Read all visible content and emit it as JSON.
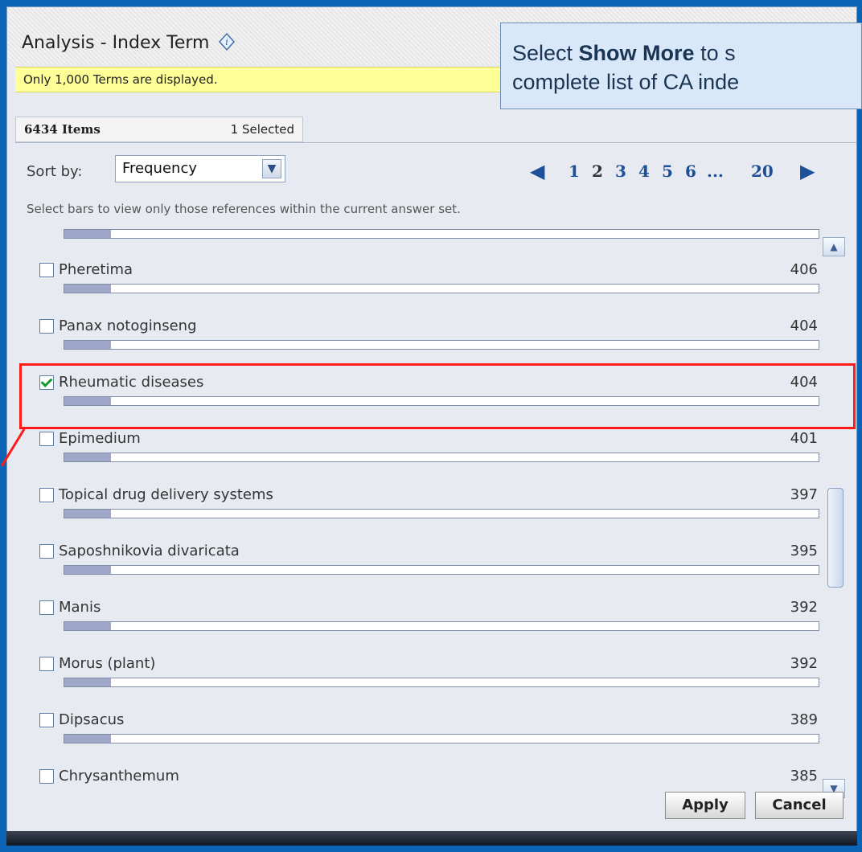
{
  "window": {
    "title": "Analysis - Index Term",
    "notice": "Only 1,000 Terms are displayed.",
    "items_count": "6434 Items",
    "selected_count": "1 Selected"
  },
  "sort": {
    "label": "Sort by:",
    "value": "Frequency"
  },
  "pagination": {
    "pages": [
      "1",
      "2",
      "3",
      "4",
      "5",
      "6",
      "...",
      "20"
    ],
    "current": "2"
  },
  "hint": "Select bars to view only those references within the current answer set.",
  "rows": [
    {
      "term": "Pheretima",
      "count": "406",
      "checked": false
    },
    {
      "term": "Panax notoginseng",
      "count": "404",
      "checked": false
    },
    {
      "term": "Rheumatic diseases",
      "count": "404",
      "checked": true
    },
    {
      "term": "Epimedium",
      "count": "401",
      "checked": false
    },
    {
      "term": "Topical drug delivery systems",
      "count": "397",
      "checked": false
    },
    {
      "term": "Saposhnikovia divaricata",
      "count": "395",
      "checked": false
    },
    {
      "term": "Manis",
      "count": "392",
      "checked": false
    },
    {
      "term": "Morus (plant)",
      "count": "392",
      "checked": false
    },
    {
      "term": "Dipsacus",
      "count": "389",
      "checked": false
    },
    {
      "term": "Chrysanthemum",
      "count": "385",
      "checked": false
    }
  ],
  "actions": {
    "apply": "Apply",
    "cancel": "Cancel"
  },
  "callout": {
    "line1_prefix": "Select ",
    "line1_bold": "Show More",
    "line1_suffix": " to s",
    "line2": "complete list of CA inde"
  },
  "icons": {
    "info": "info-icon",
    "sort_arrow": "chevron-down-icon",
    "prev_page": "triangle-left-icon",
    "next_page": "triangle-right-icon",
    "scroll_up": "chevron-up-icon",
    "scroll_down": "chevron-down-icon"
  },
  "colors": {
    "frame": "#0b63b6",
    "highlight": "#ff1a1a",
    "notice": "#ffff98",
    "bar_fill": "#9ea7c8",
    "link": "#1e4f99"
  }
}
